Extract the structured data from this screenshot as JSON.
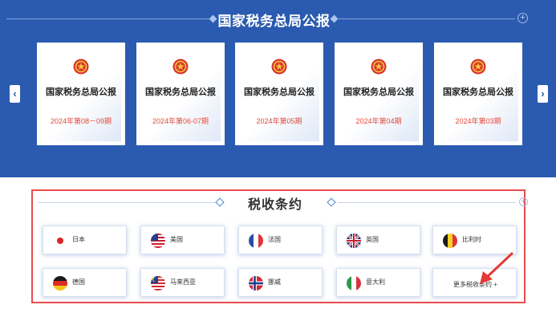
{
  "gazette": {
    "title": "国家税务总局公报",
    "prev_symbol": "‹",
    "next_symbol": "›",
    "expand_symbol": "+",
    "cards": [
      {
        "title": "国家税务总局公报",
        "issue": "2024年第08－09期"
      },
      {
        "title": "国家税务总局公报",
        "issue": "2024年第06-07期"
      },
      {
        "title": "国家税务总局公报",
        "issue": "2024年第05期"
      },
      {
        "title": "国家税务总局公报",
        "issue": "2024年第04期"
      },
      {
        "title": "国家税务总局公报",
        "issue": "2024年第03期"
      }
    ]
  },
  "treaty": {
    "title": "税收条约",
    "expand_symbol": "+",
    "countries": [
      {
        "name": "日本",
        "flag": "japan-flag-icon"
      },
      {
        "name": "美国",
        "flag": "usa-flag-icon"
      },
      {
        "name": "法国",
        "flag": "france-flag-icon"
      },
      {
        "name": "英国",
        "flag": "uk-flag-icon"
      },
      {
        "name": "比利时",
        "flag": "belgium-flag-icon"
      },
      {
        "name": "德国",
        "flag": "germany-flag-icon"
      },
      {
        "name": "马来西亚",
        "flag": "malaysia-flag-icon"
      },
      {
        "name": "挪威",
        "flag": "norway-flag-icon"
      },
      {
        "name": "意大利",
        "flag": "italy-flag-icon"
      }
    ],
    "more_label": "更多税收条约 +"
  },
  "colors": {
    "band": "#2b5bb0",
    "issue_text": "#e24a3b",
    "highlight_border": "#e84c4c"
  }
}
